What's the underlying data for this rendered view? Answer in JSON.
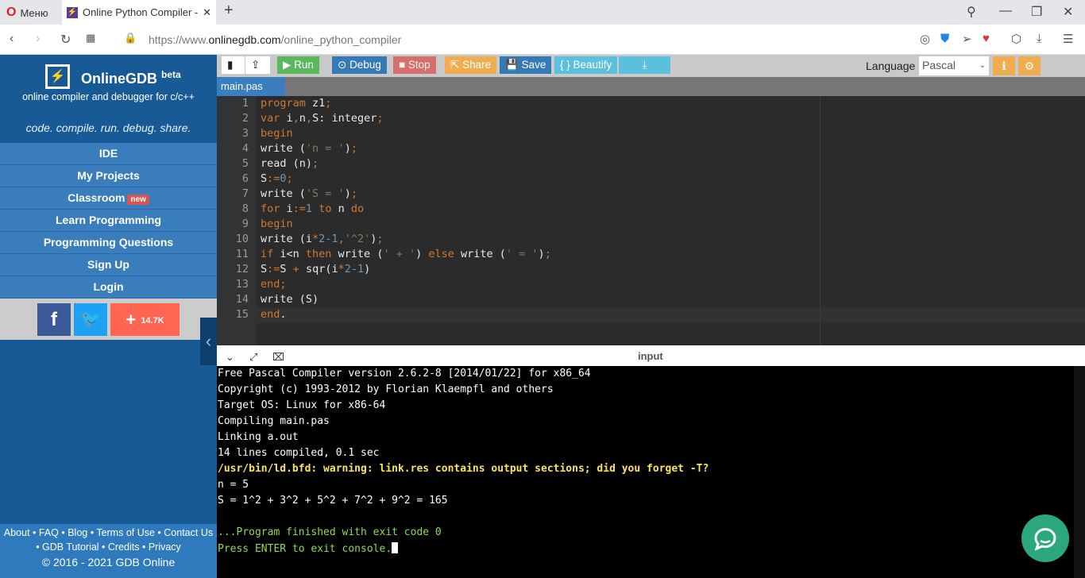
{
  "browser": {
    "menu_label": "Меню",
    "tab_title": "Online Python Compiler - o",
    "url_prefix": "https://www.",
    "url_domain": "onlinegdb.com",
    "url_path": "/online_python_compiler"
  },
  "sidebar": {
    "brand": "OnlineGDB",
    "beta": "beta",
    "subtitle": "online compiler and debugger for c/c++",
    "tagline": "code. compile. run. debug. share.",
    "items": [
      {
        "label": "IDE"
      },
      {
        "label": "My Projects"
      },
      {
        "label": "Classroom",
        "badge": "new"
      },
      {
        "label": "Learn Programming"
      },
      {
        "label": "Programming Questions"
      },
      {
        "label": "Sign Up"
      },
      {
        "label": "Login"
      }
    ],
    "share_count": "14.7K",
    "footer": {
      "line1": "About • FAQ • Blog • Terms of Use • Contact Us",
      "line2": "• GDB Tutorial • Credits • Privacy",
      "copyright": "© 2016 - 2021 GDB Online"
    }
  },
  "toolbar": {
    "run": "Run",
    "debug": "Debug",
    "stop": "Stop",
    "share": "Share",
    "save": "Save",
    "beautify": "{ } Beautify",
    "language_label": "Language",
    "language": "Pascal"
  },
  "file_tab": "main.pas",
  "code": [
    [
      [
        "program",
        "k"
      ],
      [
        " z1",
        ""
      ],
      [
        ";",
        "o"
      ]
    ],
    [
      [
        "var",
        "k"
      ],
      [
        " i",
        ""
      ],
      [
        ",",
        "o"
      ],
      [
        "n",
        ""
      ],
      [
        ",",
        "o"
      ],
      [
        "S: integer",
        ""
      ],
      [
        ";",
        "o"
      ]
    ],
    [
      [
        "begin",
        "k"
      ]
    ],
    [
      [
        "write (",
        ""
      ],
      [
        "'n = '",
        "s"
      ],
      [
        ")",
        ""
      ],
      [
        ";",
        "o"
      ]
    ],
    [
      [
        "read (n)",
        ""
      ],
      [
        ";",
        "o"
      ]
    ],
    [
      [
        "S",
        ""
      ],
      [
        ":=",
        "o"
      ],
      [
        "0",
        "n"
      ],
      [
        ";",
        "o"
      ]
    ],
    [
      [
        "write (",
        ""
      ],
      [
        "'S = '",
        "s"
      ],
      [
        ")",
        ""
      ],
      [
        ";",
        "o"
      ]
    ],
    [
      [
        "for",
        "k"
      ],
      [
        " i",
        ""
      ],
      [
        ":=",
        "o"
      ],
      [
        "1",
        "n"
      ],
      [
        " ",
        ""
      ],
      [
        "to",
        "k"
      ],
      [
        " n ",
        ""
      ],
      [
        "do",
        "k"
      ]
    ],
    [
      [
        "begin",
        "k"
      ]
    ],
    [
      [
        "write (i",
        ""
      ],
      [
        "*",
        "o"
      ],
      [
        "2-1",
        "n"
      ],
      [
        ",",
        "o"
      ],
      [
        "'^2'",
        "s"
      ],
      [
        ")",
        ""
      ],
      [
        ";",
        "o"
      ]
    ],
    [
      [
        "if",
        "k"
      ],
      [
        " i<n ",
        ""
      ],
      [
        "then",
        "k"
      ],
      [
        " write (",
        ""
      ],
      [
        "' + '",
        "s"
      ],
      [
        ") ",
        ""
      ],
      [
        "else",
        "k"
      ],
      [
        " write (",
        ""
      ],
      [
        "' = '",
        "s"
      ],
      [
        ")",
        ""
      ],
      [
        ";",
        "o"
      ]
    ],
    [
      [
        "S",
        ""
      ],
      [
        ":=",
        "o"
      ],
      [
        "S ",
        ""
      ],
      [
        "+",
        "o"
      ],
      [
        " sqr(i",
        ""
      ],
      [
        "*",
        "o"
      ],
      [
        "2-1",
        "n"
      ],
      [
        ")",
        ""
      ]
    ],
    [
      [
        "end",
        "k"
      ],
      [
        ";",
        "o"
      ]
    ],
    [
      [
        "write (S)",
        ""
      ]
    ],
    [
      [
        "end",
        "k"
      ],
      [
        ".",
        ""
      ]
    ]
  ],
  "console": {
    "header": "input",
    "lines": [
      {
        "text": "Free Pascal Compiler version 2.6.2-8 [2014/01/22] for x86_64",
        "style": ""
      },
      {
        "text": "Copyright (c) 1993-2012 by Florian Klaempfl and others",
        "style": ""
      },
      {
        "text": "Target OS: Linux for x86-64",
        "style": ""
      },
      {
        "text": "Compiling main.pas",
        "style": ""
      },
      {
        "text": "Linking a.out",
        "style": ""
      },
      {
        "text": "14 lines compiled, 0.1 sec",
        "style": ""
      },
      {
        "text": "/usr/bin/ld.bfd: warning: link.res contains output sections; did you forget -T?",
        "style": "w"
      },
      {
        "text": "n = 5",
        "style": ""
      },
      {
        "text": "S = 1^2 + 3^2 + 5^2 + 7^2 + 9^2 = 165",
        "style": ""
      },
      {
        "text": "",
        "style": ""
      },
      {
        "text": "...Program finished with exit code 0",
        "style": "g"
      },
      {
        "text": "Press ENTER to exit console.",
        "style": "g"
      }
    ]
  }
}
